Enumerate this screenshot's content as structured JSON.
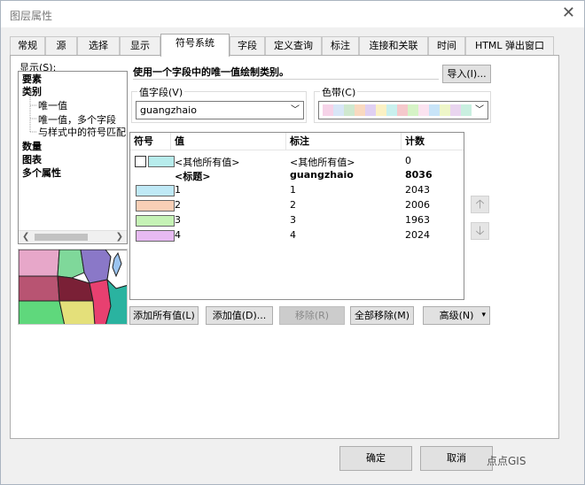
{
  "window": {
    "title": "图层属性",
    "close_glyph": "✕"
  },
  "tabs": [
    {
      "label": "常规"
    },
    {
      "label": "源"
    },
    {
      "label": "选择"
    },
    {
      "label": "显示"
    },
    {
      "label": "符号系统"
    },
    {
      "label": "字段"
    },
    {
      "label": "定义查询"
    },
    {
      "label": "标注"
    },
    {
      "label": "连接和关联"
    },
    {
      "label": "时间"
    },
    {
      "label": "HTML 弹出窗口"
    }
  ],
  "active_tab": "符号系统",
  "show_panel": {
    "label": "显示(S):",
    "tree": [
      {
        "label": "要素",
        "bold": true
      },
      {
        "label": "类别",
        "bold": true
      },
      {
        "label": "唯一值",
        "bold": false
      },
      {
        "label": "唯一值，多个字段",
        "bold": false
      },
      {
        "label": "与样式中的符号匹配",
        "bold": false
      },
      {
        "label": "数量",
        "bold": true
      },
      {
        "label": "图表",
        "bold": true
      },
      {
        "label": "多个属性",
        "bold": true
      }
    ]
  },
  "description": "使用一个字段中的唯一值绘制类别。",
  "import_button": "导入(I)...",
  "value_field": {
    "label": "值字段(V)",
    "value": "guangzhaio"
  },
  "color_ramp": {
    "label": "色带(C)",
    "colors": [
      "#f6d3e8",
      "#d8e6f7",
      "#cfe8cf",
      "#f9d9c0",
      "#e0d0f2",
      "#fbf1c4",
      "#c9f0ee",
      "#f5c9cc",
      "#d6f3c6",
      "#fbe3f0",
      "#c8e4f8",
      "#eef6c8",
      "#e9d5ef",
      "#c9efe0"
    ]
  },
  "table": {
    "headers": [
      "符号",
      "值",
      "标注",
      "计数"
    ],
    "rows": [
      {
        "swatch": "#b7ecec",
        "value": "<其他所有值>",
        "label": "<其他所有值>",
        "count": "0",
        "bold": false,
        "checkbox": true
      },
      {
        "swatch": "",
        "value": "<标题>",
        "label": "guangzhaio",
        "count": "8036",
        "bold": true,
        "checkbox": false
      },
      {
        "swatch": "#bfe9f6",
        "value": "1",
        "label": "1",
        "count": "2043",
        "bold": false,
        "checkbox": false
      },
      {
        "swatch": "#f9cfb6",
        "value": "2",
        "label": "2",
        "count": "2006",
        "bold": false,
        "checkbox": false
      },
      {
        "swatch": "#c5f2b5",
        "value": "3",
        "label": "3",
        "count": "1963",
        "bold": false,
        "checkbox": false
      },
      {
        "swatch": "#e7baf2",
        "value": "4",
        "label": "4",
        "count": "2024",
        "bold": false,
        "checkbox": false
      }
    ]
  },
  "move_up_icon": "🡡",
  "move_down_icon": "🡣",
  "buttons": {
    "add_all": "添加所有值(L)",
    "add": "添加值(D)...",
    "remove": "移除(R)",
    "remove_all": "全部移除(M)",
    "advanced": "高级(N)"
  },
  "footer": {
    "ok": "确定",
    "cancel": "取消",
    "watermark": "点点GIS"
  }
}
